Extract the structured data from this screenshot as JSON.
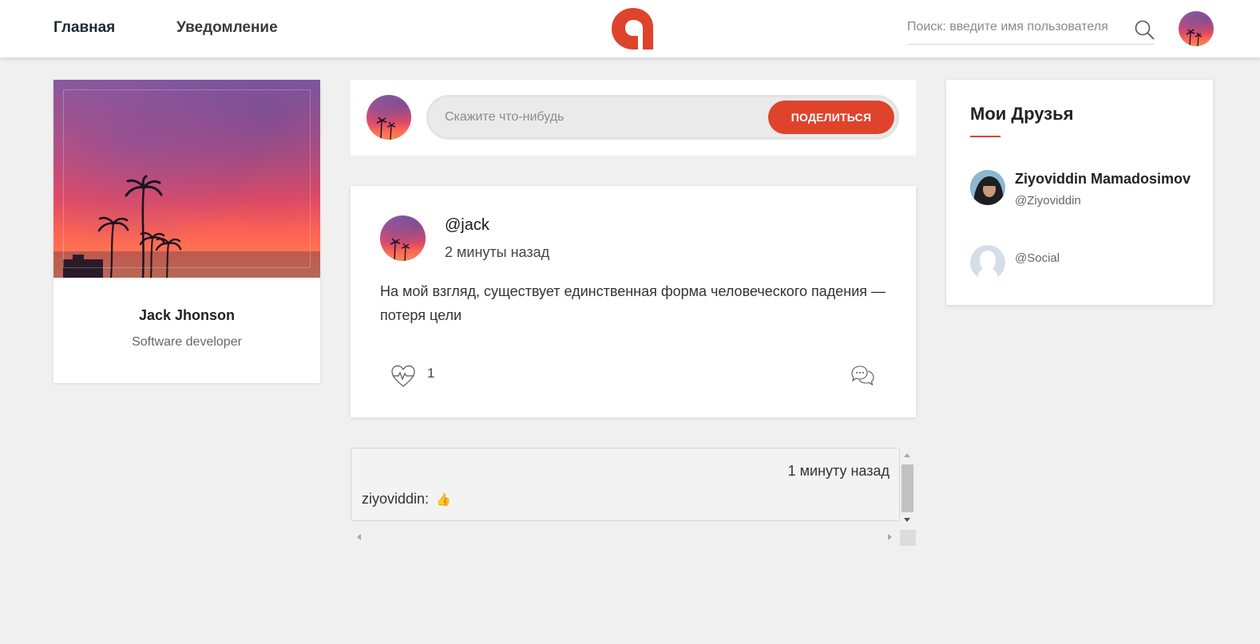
{
  "header": {
    "nav": {
      "home": "Главная",
      "notifications": "Уведомление"
    },
    "search": {
      "placeholder": "Поиск: введите имя пользователя",
      "icon": "search-icon"
    },
    "logo_icon": "app-logo",
    "avatar_icon": "user-avatar"
  },
  "profile": {
    "name": "Jack Jhonson",
    "role": "Software developer",
    "cover_icon": "sunset-palm-cover"
  },
  "composer": {
    "placeholder": "Скажите что-нибудь",
    "share_label": "ПОДЕЛИТЬСЯ"
  },
  "post": {
    "user": "@jack",
    "time": "2 минуты назад",
    "text": "На мой взгляд, существует единственная форма человеческого падения — потеря цели",
    "likes": "1",
    "like_icon": "heart-pulse-icon",
    "comment_icon": "comment-bubbles-icon"
  },
  "comments": [
    {
      "time": "1 минуту назад",
      "author": "ziyoviddin:",
      "emoji": "👍"
    }
  ],
  "friends": {
    "title": "Мои Друзья",
    "items": [
      {
        "name": "Ziyoviddin Mamadosimov",
        "handle": "@Ziyoviddin"
      },
      {
        "name": "",
        "handle": "@Social"
      }
    ]
  },
  "colors": {
    "accent": "#e0432c",
    "background": "#f0f0f0",
    "card": "#ffffff"
  }
}
